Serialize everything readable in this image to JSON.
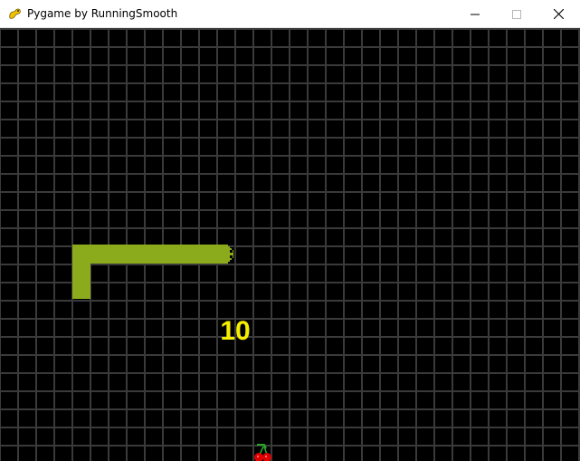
{
  "window": {
    "title": "Pygame by RunningSmooth",
    "app_icon": "pygame-snake-icon",
    "controls": [
      "minimize-icon",
      "maximize-icon",
      "close-icon"
    ]
  },
  "game": {
    "score": "10",
    "colors": {
      "background": "#000000",
      "grid": "#3a3a3a",
      "snake": "#8bab1c",
      "score": "#f5ee00",
      "cherry": "#e00000",
      "cherry_stem": "#2aa52a"
    },
    "food": "cherry-icon"
  }
}
